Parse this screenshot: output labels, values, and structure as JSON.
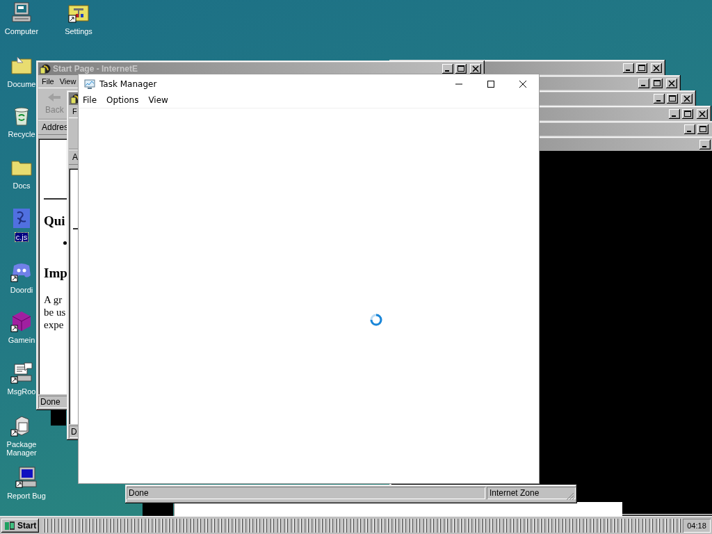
{
  "desktop": {
    "icons": [
      {
        "label": "Computer",
        "kind": "computer",
        "selected": false
      },
      {
        "label": "Settings",
        "kind": "settings",
        "selected": false
      },
      {
        "label": "Docume",
        "kind": "documents",
        "selected": false
      },
      {
        "label": "Recycle",
        "kind": "recycle",
        "selected": false
      },
      {
        "label": "Docs",
        "kind": "folder",
        "selected": false
      },
      {
        "label": "c.js",
        "kind": "script",
        "selected": true
      },
      {
        "label": "Doordi",
        "kind": "chat",
        "selected": false
      },
      {
        "label": "Gamein",
        "kind": "cube",
        "selected": false
      },
      {
        "label": "MsgRoo",
        "kind": "messenger",
        "selected": false
      },
      {
        "label": "Package Manager",
        "kind": "package",
        "selected": false
      },
      {
        "label": "Report Bug",
        "kind": "monitor",
        "selected": false
      }
    ]
  },
  "browser_windows": [
    {
      "title": "Start Page - InternetE",
      "menu": [
        "File",
        "View"
      ],
      "back": {
        "label": "Back",
        "disabled": true
      },
      "address_label": "Addres",
      "content": [
        {
          "kind": "rule"
        },
        {
          "kind": "heading",
          "text": "Qui"
        },
        {
          "kind": "bullet"
        },
        {
          "kind": "heading",
          "text": "Imp"
        },
        {
          "kind": "paragraph",
          "lines": [
            "A gr",
            "be us",
            "expe"
          ]
        }
      ],
      "status": "Done"
    },
    {
      "menu": [
        "F"
      ],
      "address_label": "A",
      "content": [
        {
          "kind": "rule"
        }
      ],
      "status": "D"
    }
  ],
  "status_window": {
    "status": "Done",
    "zone": "Internet Zone"
  },
  "task_manager": {
    "title": "Task Manager",
    "menu": [
      "File",
      "Options",
      "View"
    ],
    "loading": true
  },
  "taskbar": {
    "start": "Start",
    "clock": "04:18"
  }
}
